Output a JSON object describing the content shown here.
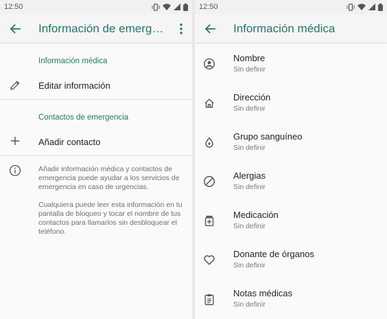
{
  "left": {
    "status": {
      "time": "12:50"
    },
    "appbar": {
      "title": "Información de emergencia"
    },
    "sections": {
      "medical_header": "Información médica",
      "edit_label": "Editar información",
      "contacts_header": "Contactos de emergencia",
      "add_contact_label": "Añadir contacto"
    },
    "info": {
      "paragraph1": "Añadir información médica y contactos de emergencia puede ayudar a los servicios de emergencia en caso de urgencias.",
      "paragraph2": "Cualquiera puede leer esta información en tu pantalla de bloqueo y tocar el nombre de tus contactos para llamarlos sin desbloquear el teléfono."
    }
  },
  "right": {
    "status": {
      "time": "12:50"
    },
    "appbar": {
      "title": "Información médica"
    },
    "items": [
      {
        "title": "Nombre",
        "value": "Sin definir",
        "icon": "account-circle-icon"
      },
      {
        "title": "Dirección",
        "value": "Sin definir",
        "icon": "home-icon"
      },
      {
        "title": "Grupo sanguíneo",
        "value": "Sin definir",
        "icon": "blood-drop-icon"
      },
      {
        "title": "Alergias",
        "value": "Sin definir",
        "icon": "block-icon"
      },
      {
        "title": "Medicación",
        "value": "Sin definir",
        "icon": "medication-icon"
      },
      {
        "title": "Donante de órganos",
        "value": "Sin definir",
        "icon": "heart-icon"
      },
      {
        "title": "Notas médicas",
        "value": "Sin definir",
        "icon": "clipboard-icon"
      }
    ]
  },
  "colors": {
    "accent": "#1d7b6a",
    "background": "#fafafa",
    "text": "#222222",
    "secondary_text": "#7a7a7a"
  }
}
